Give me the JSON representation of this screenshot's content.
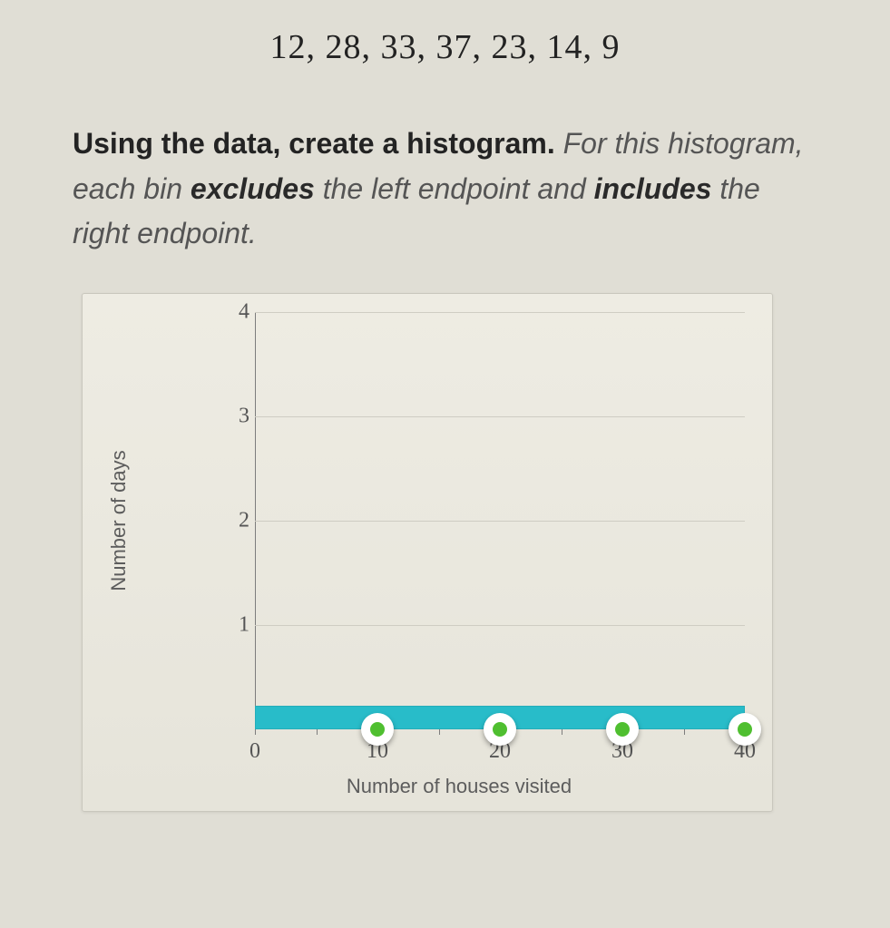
{
  "data_list_text": "12, 28, 33, 37, 23, 14, 9",
  "instruction": {
    "lead_bold": "Using the data, create a histogram.",
    "rest_1": " For this histogram, each bin ",
    "excludes": "excludes",
    "rest_2": " the left endpoint and ",
    "includes": "includes",
    "rest_3": " the right endpoint."
  },
  "chart_data": {
    "type": "bar",
    "title": "",
    "xlabel": "Number of houses visited",
    "ylabel": "Number of days",
    "ylim": [
      0,
      4
    ],
    "y_ticks": [
      1,
      2,
      3,
      4
    ],
    "x_ticks": [
      0,
      10,
      20,
      30,
      40
    ],
    "x_minor_step": 5,
    "categories": [
      "0–10",
      "10–20",
      "20–30",
      "30–40"
    ],
    "values": [
      0,
      0,
      0,
      0
    ],
    "handles_x": [
      10,
      20,
      30,
      40
    ],
    "bar_strip_height_units": 0.22
  }
}
